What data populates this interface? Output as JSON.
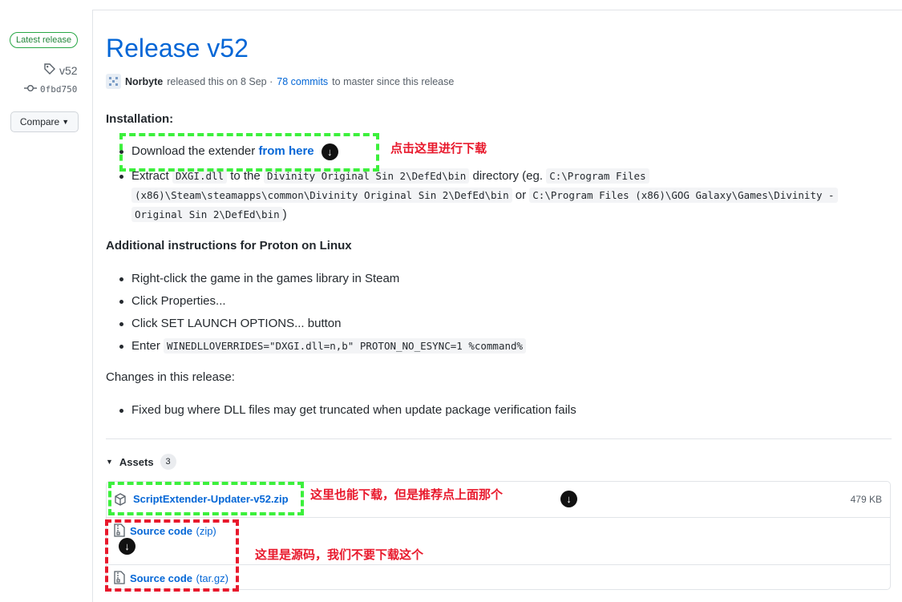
{
  "sidebar": {
    "latest_badge": "Latest release",
    "tag": "v52",
    "commit": "0fbd750",
    "compare": "Compare"
  },
  "release": {
    "title": "Release v52",
    "author": "Norbyte",
    "released_text": "released this on 8 Sep ·",
    "commits_link": "78 commits",
    "since_text": "to master since this release"
  },
  "installation": {
    "heading": "Installation:",
    "download_text": "Download the extender ",
    "download_link": "from here",
    "extract_pre": "Extract ",
    "extract_code1": "DXGI.dll",
    "extract_mid": " to the ",
    "extract_code2": "Divinity Original Sin 2\\DefEd\\bin",
    "extract_dir": " directory (eg. ",
    "extract_code3": "C:\\Program Files",
    "extract_code4": "(x86)\\Steam\\steamapps\\common\\Divinity Original Sin 2\\DefEd\\bin",
    "extract_or": " or ",
    "extract_code5": "C:\\Program Files (x86)\\GOG Galaxy\\Games\\Divinity -",
    "extract_code6": "Original Sin 2\\DefEd\\bin",
    "extract_end": ")"
  },
  "proton": {
    "heading": "Additional instructions for Proton on Linux",
    "items": [
      "Right-click the game in the games library in Steam",
      "Click Properties...",
      "Click SET LAUNCH OPTIONS... button"
    ],
    "enter_label": "Enter ",
    "enter_code": "WINEDLLOVERRIDES=\"DXGI.dll=n,b\" PROTON_NO_ESYNC=1 %command%"
  },
  "changes": {
    "heading": "Changes in this release:",
    "items": [
      "Fixed bug where DLL files may get truncated when update package verification fails"
    ]
  },
  "assets": {
    "label": "Assets",
    "count": "3",
    "items": [
      {
        "name": "ScriptExtender-Updater-v52.zip",
        "size": "479 KB"
      },
      {
        "name": "Source code",
        "suffix": "(zip)"
      },
      {
        "name": "Source code",
        "suffix": "(tar.gz)"
      }
    ]
  },
  "annotations": {
    "click_here": "点击这里进行下载",
    "also_download": "这里也能下载，但是推荐点上面那个",
    "source_code": "这里是源码，我们不要下载这个"
  },
  "colors": {
    "link": "#0366d6",
    "green_box": "#3cf03c",
    "red_box": "#e8192c",
    "badge_green": "#28a745"
  }
}
